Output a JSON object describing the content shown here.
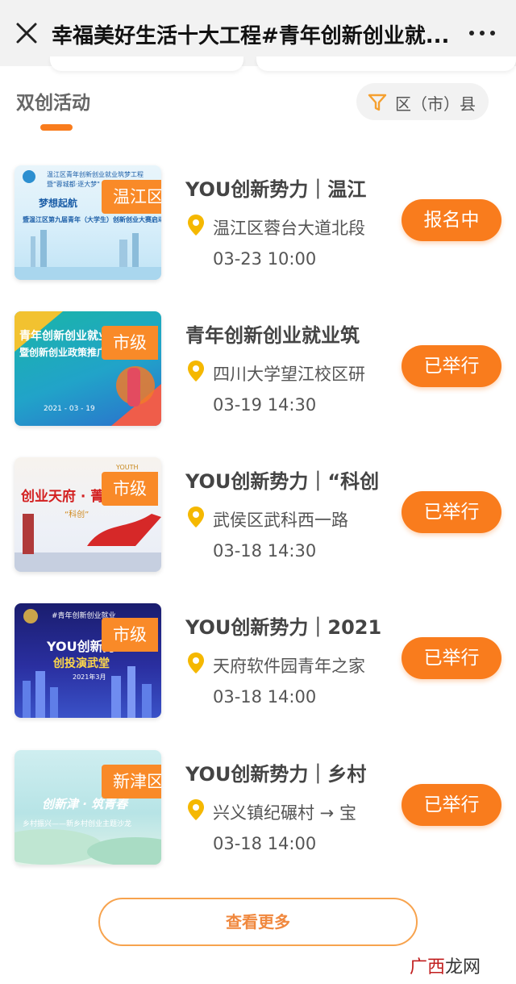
{
  "header": {
    "title": "幸福美好生活十大工程#青年创新创业就..."
  },
  "section": {
    "title": "双创活动",
    "filter_label": "区（市）县"
  },
  "events": [
    {
      "tag": "温江区",
      "title": "YOU创新势力｜温江",
      "location": "温江区蓉台大道北段",
      "time": "03-23 10:00",
      "status": "报名中",
      "poster_lines": [
        "温江区青年创新创业就业筑梦工程",
        "暨\"蓉城都·逐大梦\"",
        "梦想起航",
        "暨温江区第九届青年（大学生）创新创业大赛启动仪式"
      ]
    },
    {
      "tag": "市级",
      "title": "青年创新创业就业筑",
      "location": "四川大学望江校区研",
      "time": "03-19 14:30",
      "status": "已举行",
      "poster_lines": [
        "青年创新创业就业筑梦工",
        "暨创新创业政策推广会",
        "2021 - 03 - 19"
      ]
    },
    {
      "tag": "市级",
      "title": "YOU创新势力｜“科创",
      "location": "武侯区武科西一路",
      "time": "03-18 14:30",
      "status": "已举行",
      "poster_lines": [
        "创业天府 · 菁",
        "“科创”",
        "YOUTH"
      ]
    },
    {
      "tag": "市级",
      "title": "YOU创新势力｜2021",
      "location": "天府软件园青年之家",
      "time": "03-18 14:00",
      "status": "已举行",
      "poster_lines": [
        "#青年创新创业就业",
        "YOU创新势",
        "创投演武堂",
        "2021年3月"
      ]
    },
    {
      "tag": "新津区",
      "title": "YOU创新势力｜乡村",
      "location": "兴义镇纪碾村 → 宝",
      "time": "03-18 14:00",
      "status": "已举行",
      "poster_lines": [
        "创新津 · 筑青春",
        "乡村振兴——新乡村创业主题沙龙"
      ]
    }
  ],
  "load_more": "查看更多",
  "watermark": {
    "left": "广西",
    "right": "龙网"
  },
  "colors": {
    "accent": "#f97c1d",
    "tag": "#f98a28",
    "pin": "#f5b800"
  }
}
